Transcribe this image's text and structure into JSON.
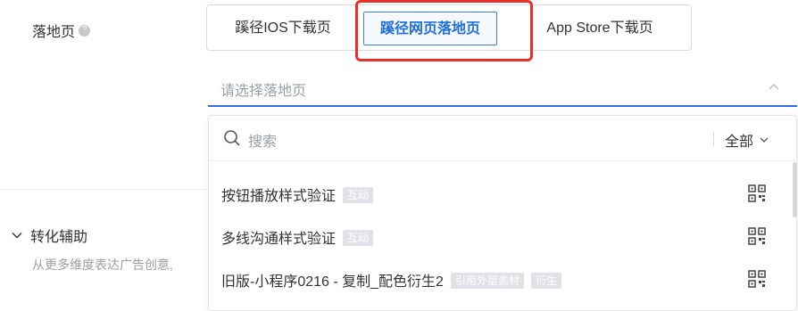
{
  "landing": {
    "label": "落地页",
    "help_glyph": "?",
    "options": [
      "蹊径IOS下载页",
      "蹊径网页落地页",
      "App Store下载页"
    ],
    "selected": "蹊径网页落地页"
  },
  "select": {
    "placeholder": "请选择落地页"
  },
  "dropdown": {
    "search_placeholder": "搜索",
    "filter_label": "全部",
    "items": [
      {
        "name": "按钮播放样式验证",
        "tags": [
          "互动"
        ]
      },
      {
        "name": "多线沟通样式验证",
        "tags": [
          "互动"
        ]
      },
      {
        "name": "旧版-小程序0216 - 复制_配色衍生2",
        "tags": [
          "引用外层素材",
          "衍生"
        ]
      }
    ]
  },
  "conversion": {
    "title": "转化辅助",
    "description": "从更多维度表达广告创意,"
  },
  "colors": {
    "accent": "#1f6fe0",
    "highlight_border": "#e8302a",
    "tag_bg": "#dfe2e6"
  }
}
